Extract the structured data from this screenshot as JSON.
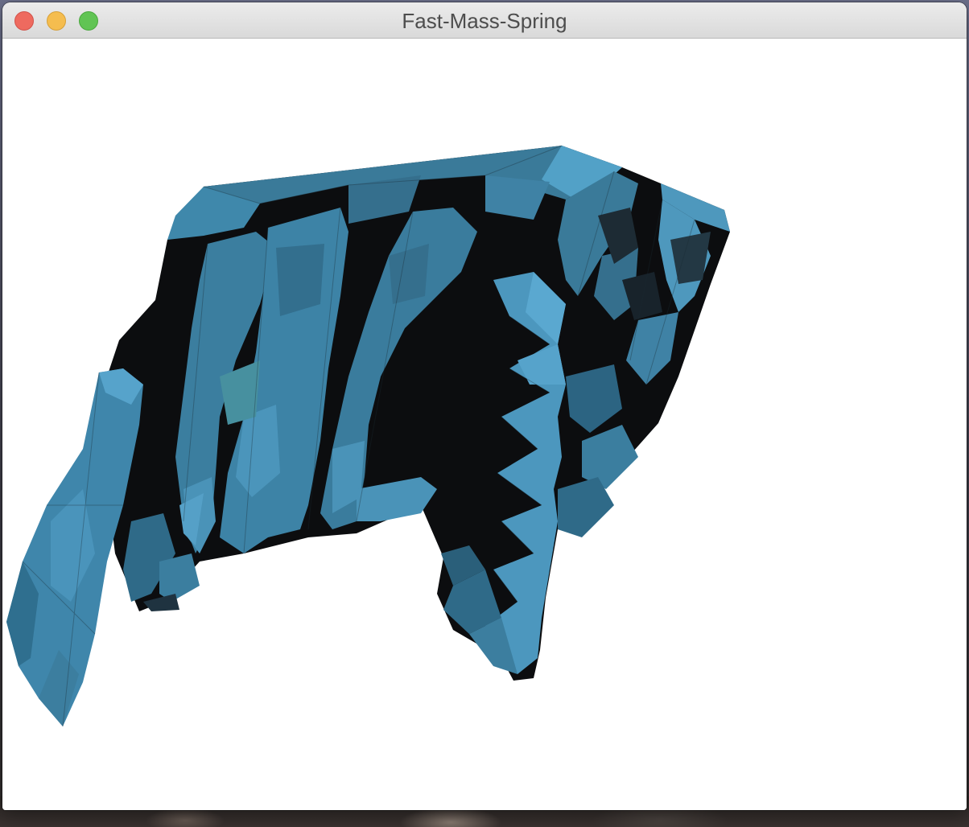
{
  "window": {
    "title": "Fast-Mass-Spring",
    "controls": {
      "close": "close-icon",
      "minimize": "minimize-icon",
      "zoom": "zoom-icon"
    }
  },
  "scene": {
    "background_color": "#ffffff",
    "mesh_color": "#4f9ec6",
    "shadow_color": "#0c0d0f"
  }
}
